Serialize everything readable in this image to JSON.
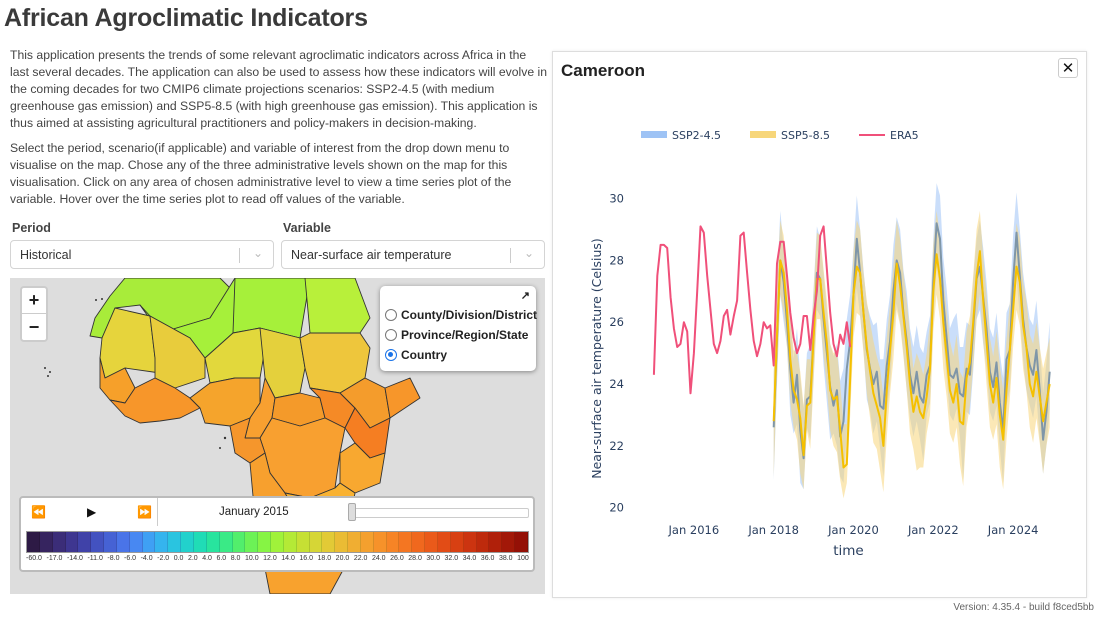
{
  "app": {
    "title": "African Agroclimatic Indicators",
    "intro_paragraphs": [
      "This application presents the trends of some relevant agroclimatic indicators across Africa in the last several decades. The application can also be used to assess how these indicators will evolve in the coming decades for two CMIP6 climate projections scenarios: SSP2-4.5 (with medium greenhouse gas emission) and SSP5-8.5 (with high greenhouse gas emission). This application is thus aimed at assisting agricultural practitioners and policy-makers in decision-making.",
      "Select the period, scenario(if applicable) and variable of interest from the drop down menu to visualise on the map. Chose any of the three administrative levels shown on the map for this visualisation. Click on any area of chosen administrative level to view a time series plot of the variable. Hover over the time series plot to read off values of the variable."
    ],
    "version": "Version: 4.35.4 - build f8ced5bb"
  },
  "controls": {
    "period": {
      "label": "Period",
      "value": "Historical"
    },
    "variable": {
      "label": "Variable",
      "value": "Near-surface air temperature"
    }
  },
  "map": {
    "zoom_in": "+",
    "zoom_out": "−",
    "layers": {
      "expand_icon": "↗",
      "options": [
        {
          "label": "County/Division/District",
          "selected": false
        },
        {
          "label": "Province/Region/State",
          "selected": false
        },
        {
          "label": "Country",
          "selected": true
        }
      ]
    },
    "time_control": {
      "rewind_icon": "⏪",
      "play_icon": "▶",
      "forward_icon": "⏩",
      "current_date": "January 2015",
      "slider_position": 0
    },
    "colorbar": {
      "colors": [
        "#2d1a45",
        "#36245f",
        "#3b2d78",
        "#3e3690",
        "#4042a8",
        "#4352c0",
        "#4662d4",
        "#4a74e8",
        "#4888f2",
        "#3fa0f4",
        "#35b4ee",
        "#2ac4e0",
        "#22d1cc",
        "#20dcb6",
        "#28e49e",
        "#3aea86",
        "#52ee6c",
        "#6cf256",
        "#86f444",
        "#a0f23a",
        "#b4ea36",
        "#c6e034",
        "#d6d636",
        "#e2ca36",
        "#eabc34",
        "#f0ae32",
        "#f4a02e",
        "#f6922a",
        "#f68426",
        "#f47622",
        "#f0681e",
        "#ea5a1a",
        "#e24c16",
        "#d84012",
        "#cc3410",
        "#be2a0c",
        "#b0200a",
        "#a21808",
        "#941006"
      ],
      "tick_labels": [
        "-60.0",
        "-17.0",
        "-14.0",
        "-11.0",
        "-8.0",
        "-6.0",
        "-4.0",
        "-2.0",
        "0.0",
        "2.0",
        "4.0",
        "6.0",
        "8.0",
        "10.0",
        "12.0",
        "14.0",
        "16.0",
        "18.0",
        "20.0",
        "22.0",
        "24.0",
        "26.0",
        "28.0",
        "30.0",
        "32.0",
        "34.0",
        "36.0",
        "38.0",
        "100"
      ]
    }
  },
  "panel": {
    "title": "Cameroon",
    "close_icon": "✕"
  },
  "chart_data": {
    "type": "line",
    "title": "Cameroon",
    "xlabel": "time",
    "ylabel": "Near-surface air temperature (Celsius)",
    "ylim": [
      19.7,
      30.6
    ],
    "yticks": [
      20,
      22,
      24,
      26,
      28,
      30
    ],
    "xticks": [
      {
        "label": "Jan 2016",
        "year": 2016
      },
      {
        "label": "Jan 2018",
        "year": 2018
      },
      {
        "label": "Jan 2020",
        "year": 2020
      },
      {
        "label": "Jan 2022",
        "year": 2022
      },
      {
        "label": "Jan 2024",
        "year": 2024
      }
    ],
    "xlim_years": [
      2014.35,
      2025.5
    ],
    "legend_position": "top",
    "grid": false,
    "series": [
      {
        "name": "SSP2-4.5",
        "kind": "band",
        "color": "#1f6fe0",
        "band_color": "#9ec3f5",
        "start": "2018-01",
        "mean": [
          22.6,
          25.5,
          28.0,
          27.3,
          26.0,
          24.5,
          23.4,
          24.3,
          22.5,
          21.6,
          23.5,
          23.6,
          25.6,
          27.6,
          27.4,
          26.1,
          25.0,
          23.9,
          23.3,
          23.8,
          22.3,
          22.8,
          24.5,
          25.4,
          26.9,
          28.7,
          27.6,
          26.3,
          25.1,
          24.5,
          24.0,
          24.4,
          23.3,
          23.2,
          24.6,
          25.4,
          27.0,
          28.0,
          27.6,
          26.3,
          25.4,
          24.3,
          23.7,
          24.4,
          23.6,
          23.4,
          24.3,
          24.6,
          27.3,
          29.2,
          28.7,
          26.7,
          25.5,
          24.3,
          24.2,
          24.5,
          23.7,
          23.6,
          24.5,
          24.3,
          25.8,
          27.4,
          27.8,
          26.8,
          25.8,
          24.4,
          23.9,
          24.7,
          23.4,
          22.5,
          24.8,
          25.1,
          27.3,
          28.9,
          27.5,
          26.1,
          25.2,
          24.6,
          24.3,
          25.1,
          23.8,
          22.2,
          23.1,
          24.4
        ],
        "lower": [
          20.9,
          24.0,
          26.9,
          26.0,
          25.2,
          23.0,
          22.4,
          22.7,
          20.8,
          20.6,
          22.6,
          22.2,
          24.2,
          26.4,
          26.2,
          24.6,
          23.4,
          22.2,
          22.4,
          22.0,
          21.0,
          20.8,
          22.4,
          24.0,
          25.8,
          27.1,
          26.2,
          25.1,
          23.5,
          23.1,
          22.4,
          22.8,
          21.9,
          21.0,
          23.1,
          24.0,
          25.6,
          26.6,
          26.0,
          25.0,
          23.8,
          22.9,
          22.3,
          22.8,
          22.2,
          21.5,
          23.0,
          23.4,
          26.0,
          27.8,
          27.0,
          25.4,
          24.2,
          23.0,
          22.8,
          23.2,
          22.3,
          20.9,
          23.1,
          23.0,
          24.4,
          26.1,
          26.4,
          25.3,
          24.5,
          23.1,
          22.8,
          23.3,
          21.9,
          20.8,
          23.3,
          23.8,
          25.9,
          27.4,
          26.2,
          24.8,
          23.8,
          23.3,
          22.9,
          23.6,
          22.2,
          21.1,
          22.0,
          23.2
        ],
        "upper": [
          24.3,
          27.2,
          29.6,
          28.4,
          27.1,
          26.2,
          24.8,
          25.8,
          24.2,
          23.2,
          25.0,
          25.3,
          27.1,
          29.1,
          28.7,
          27.6,
          26.4,
          25.3,
          24.9,
          25.3,
          24.1,
          24.5,
          26.1,
          26.9,
          28.4,
          30.1,
          29.0,
          27.7,
          26.6,
          26.2,
          25.9,
          26.0,
          24.8,
          24.8,
          26.1,
          26.9,
          28.5,
          29.4,
          29.0,
          27.7,
          27.0,
          25.8,
          25.2,
          25.9,
          25.2,
          25.0,
          25.7,
          26.2,
          28.7,
          30.5,
          30.1,
          28.1,
          27.1,
          25.8,
          26.1,
          26.3,
          25.2,
          25.2,
          26.0,
          25.9,
          27.4,
          28.7,
          29.3,
          28.4,
          27.3,
          25.8,
          25.5,
          26.3,
          25.0,
          24.2,
          26.3,
          26.6,
          28.8,
          30.2,
          29.0,
          27.6,
          26.8,
          26.1,
          25.9,
          26.7,
          25.3,
          23.7,
          24.7,
          26.0
        ]
      },
      {
        "name": "SSP5-8.5",
        "kind": "band",
        "color": "#f5c000",
        "band_color": "#f7d67a",
        "start": "2018-01",
        "mean": [
          22.8,
          25.6,
          28.0,
          27.6,
          26.4,
          24.8,
          23.8,
          23.5,
          22.9,
          21.7,
          23.3,
          23.4,
          25.5,
          27.4,
          27.4,
          26.3,
          25.3,
          23.8,
          23.5,
          23.6,
          22.5,
          21.3,
          21.4,
          24.2,
          26.9,
          27.8,
          27.6,
          26.3,
          25.2,
          24.4,
          23.7,
          23.3,
          22.9,
          22.0,
          23.8,
          25.1,
          26.3,
          27.9,
          27.2,
          26.2,
          25.2,
          24.0,
          23.1,
          23.6,
          23.1,
          22.9,
          23.6,
          24.5,
          27.0,
          28.2,
          27.4,
          26.0,
          24.9,
          23.8,
          23.4,
          24.0,
          22.8,
          22.7,
          24.2,
          24.7,
          26.0,
          27.5,
          28.3,
          26.7,
          25.4,
          24.0,
          23.4,
          24.2,
          23.0,
          22.2,
          23.8,
          25.1,
          26.4,
          27.8,
          27.3,
          25.9,
          25.2,
          24.0,
          23.6,
          24.4,
          23.6,
          22.8,
          23.4,
          24.0
        ],
        "lower": [
          21.0,
          24.2,
          26.9,
          26.3,
          25.2,
          23.4,
          22.6,
          22.2,
          21.1,
          20.6,
          22.5,
          21.9,
          24.1,
          26.1,
          26.1,
          24.9,
          23.9,
          22.5,
          22.0,
          21.8,
          20.9,
          20.3,
          20.8,
          23.0,
          25.5,
          26.3,
          26.2,
          25.0,
          23.7,
          22.9,
          22.1,
          21.9,
          21.2,
          20.5,
          22.3,
          23.7,
          24.8,
          26.4,
          25.9,
          24.9,
          23.8,
          22.4,
          21.9,
          21.2,
          21.3,
          21.3,
          22.4,
          23.0,
          25.7,
          26.9,
          26.1,
          24.5,
          23.6,
          22.4,
          22.1,
          22.6,
          21.4,
          20.7,
          22.6,
          23.3,
          24.6,
          26.1,
          26.9,
          25.4,
          24.0,
          22.6,
          22.2,
          22.7,
          21.3,
          20.6,
          22.2,
          23.5,
          25.2,
          26.4,
          25.9,
          24.5,
          23.8,
          22.6,
          22.1,
          22.9,
          22.1,
          21.1,
          22.0,
          22.6
        ],
        "upper": [
          24.4,
          27.2,
          29.3,
          28.8,
          27.6,
          26.2,
          25.1,
          25.0,
          24.4,
          23.3,
          24.8,
          24.8,
          27.0,
          28.9,
          28.8,
          27.7,
          26.7,
          25.3,
          25.0,
          25.1,
          24.0,
          22.7,
          22.7,
          25.6,
          28.3,
          29.3,
          29.0,
          27.6,
          26.7,
          26.0,
          25.4,
          24.9,
          24.5,
          23.6,
          25.5,
          26.6,
          27.8,
          29.3,
          28.7,
          27.6,
          26.7,
          25.6,
          24.5,
          25.0,
          24.7,
          24.3,
          25.0,
          26.0,
          28.5,
          29.6,
          28.8,
          27.4,
          26.4,
          25.4,
          24.9,
          25.6,
          24.4,
          24.2,
          25.7,
          26.2,
          27.5,
          29.0,
          29.6,
          28.1,
          26.9,
          25.5,
          24.9,
          25.7,
          24.6,
          23.8,
          25.4,
          26.6,
          27.8,
          29.2,
          28.7,
          27.3,
          26.7,
          25.6,
          25.3,
          26.0,
          25.2,
          24.5,
          25.0,
          25.5
        ]
      },
      {
        "name": "ERA5",
        "kind": "line",
        "color": "#f0507a",
        "start": "2015-01",
        "values": [
          24.3,
          27.5,
          28.5,
          28.5,
          28.4,
          26.8,
          25.8,
          25.2,
          25.3,
          26.0,
          25.7,
          23.7,
          25.0,
          27.0,
          29.1,
          28.9,
          27.5,
          26.4,
          25.3,
          25.0,
          25.4,
          26.2,
          26.4,
          25.6,
          26.2,
          26.7,
          28.8,
          28.9,
          27.6,
          26.4,
          25.4,
          24.9,
          25.3,
          26.0,
          25.8,
          25.9,
          24.6,
          27.9,
          28.6,
          28.6,
          27.5,
          26.3,
          25.5,
          25.0,
          25.3,
          26.2,
          26.2,
          25.1,
          26.2,
          27.0,
          28.8,
          29.1,
          27.7,
          26.3,
          25.3,
          24.9,
          25.6,
          25.3,
          26.0,
          25.2
        ]
      }
    ]
  }
}
